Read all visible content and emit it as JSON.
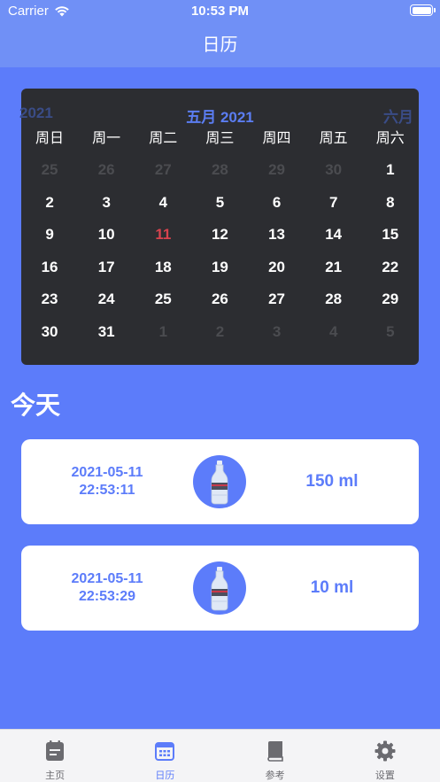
{
  "status_bar": {
    "carrier": "Carrier",
    "time": "10:53 PM"
  },
  "nav": {
    "title": "日历"
  },
  "calendar": {
    "prev_label": "2021",
    "title": "五月 2021",
    "next_label": "六月",
    "weekdays": [
      "周日",
      "周一",
      "周二",
      "周三",
      "周四",
      "周五",
      "周六"
    ],
    "days": [
      {
        "d": "25",
        "m": true
      },
      {
        "d": "26",
        "m": true
      },
      {
        "d": "27",
        "m": true
      },
      {
        "d": "28",
        "m": true
      },
      {
        "d": "29",
        "m": true
      },
      {
        "d": "30",
        "m": true
      },
      {
        "d": "1"
      },
      {
        "d": "2"
      },
      {
        "d": "3"
      },
      {
        "d": "4"
      },
      {
        "d": "5"
      },
      {
        "d": "6"
      },
      {
        "d": "7"
      },
      {
        "d": "8"
      },
      {
        "d": "9"
      },
      {
        "d": "10"
      },
      {
        "d": "11",
        "t": true
      },
      {
        "d": "12"
      },
      {
        "d": "13"
      },
      {
        "d": "14"
      },
      {
        "d": "15"
      },
      {
        "d": "16"
      },
      {
        "d": "17"
      },
      {
        "d": "18"
      },
      {
        "d": "19"
      },
      {
        "d": "20"
      },
      {
        "d": "21"
      },
      {
        "d": "22"
      },
      {
        "d": "23"
      },
      {
        "d": "24"
      },
      {
        "d": "25"
      },
      {
        "d": "26"
      },
      {
        "d": "27"
      },
      {
        "d": "28"
      },
      {
        "d": "29"
      },
      {
        "d": "30"
      },
      {
        "d": "31"
      },
      {
        "d": "1",
        "m": true
      },
      {
        "d": "2",
        "m": true
      },
      {
        "d": "3",
        "m": true
      },
      {
        "d": "4",
        "m": true
      },
      {
        "d": "5",
        "m": true
      }
    ]
  },
  "today": {
    "title": "今天",
    "records": [
      {
        "date": "2021-05-11",
        "time": "22:53:11",
        "amount": "150 ml",
        "icon": "water-bottle-icon"
      },
      {
        "date": "2021-05-11",
        "time": "22:53:29",
        "amount": "10 ml",
        "icon": "water-bottle-icon"
      }
    ]
  },
  "tabs": [
    {
      "label": "主页",
      "icon": "note-icon",
      "active": false
    },
    {
      "label": "日历",
      "icon": "calendar-icon",
      "active": true
    },
    {
      "label": "参考",
      "icon": "book-icon",
      "active": false
    },
    {
      "label": "设置",
      "icon": "gear-icon",
      "active": false
    }
  ],
  "colors": {
    "primary": "#5c7cfa",
    "bar": "#7090f6",
    "calendar_bg": "#2c2d31",
    "today": "#d8434e"
  }
}
